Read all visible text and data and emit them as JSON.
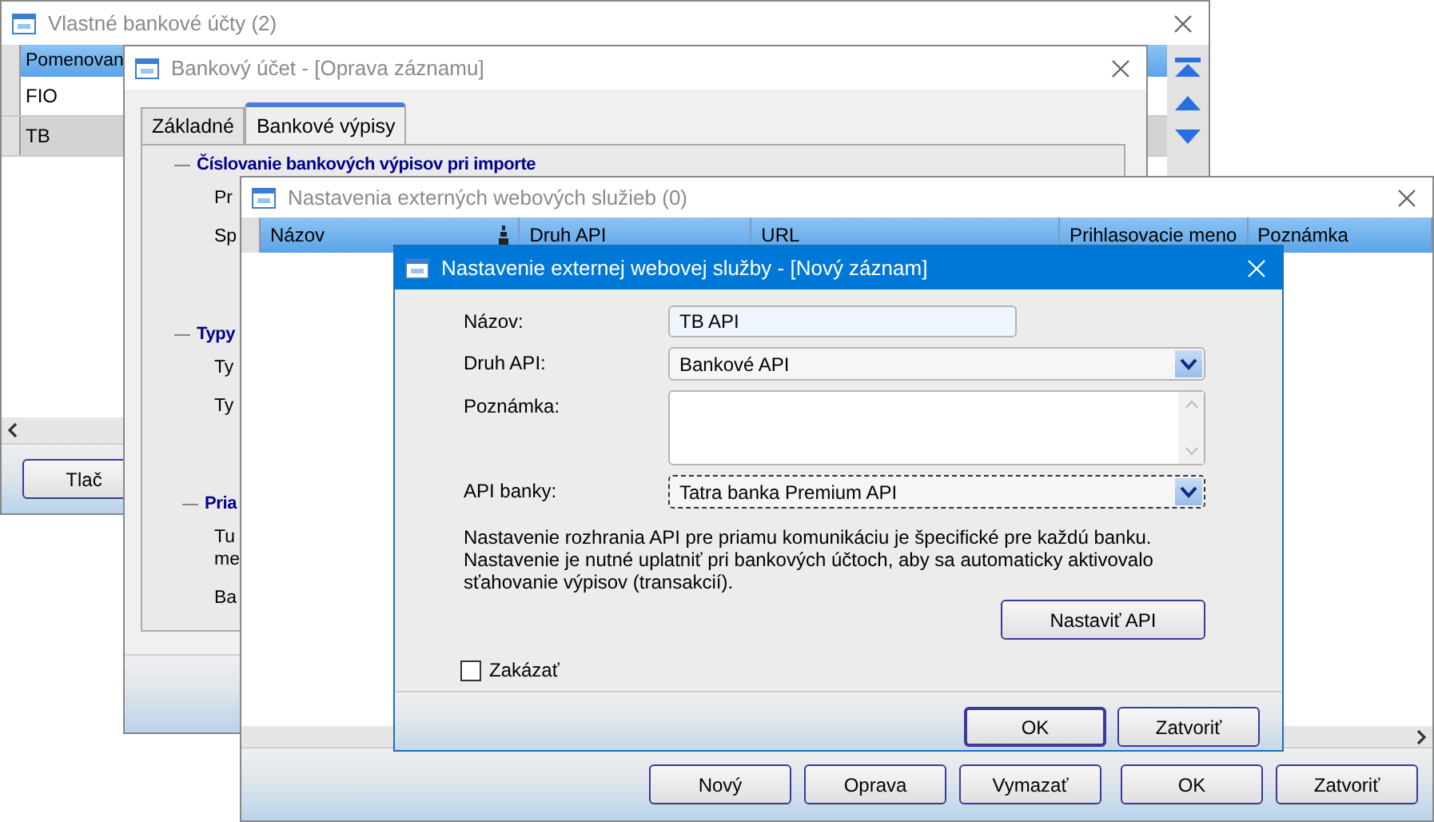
{
  "accounts_window": {
    "title": "Vlastné bankové účty (2)",
    "columns": [
      "Pomenovan"
    ],
    "rows": [
      {
        "cells": [
          "FIO"
        ],
        "selected": false
      },
      {
        "cells": [
          "TB"
        ],
        "selected": true
      }
    ],
    "buttons": [
      "Tlač"
    ]
  },
  "account_window": {
    "title": "Bankový účet - [Oprava záznamu]",
    "tabs": [
      {
        "label": "Základné",
        "selected": false
      },
      {
        "label": "Bankové výpisy",
        "selected": true
      }
    ],
    "sections": [
      {
        "heading": "Číslovanie bankových výpisov pri importe",
        "lines": [
          "Pr",
          "Sp"
        ]
      },
      {
        "heading": "Typy",
        "lines": [
          "Ty",
          "Ty"
        ]
      },
      {
        "heading": "Pria",
        "lines": [
          "Tu\nme",
          "Ba"
        ]
      }
    ]
  },
  "services_window": {
    "title": "Nastavenia externých webových služieb (0)",
    "columns": [
      "Názov",
      "Druh API",
      "URL",
      "Prihlasovacie meno",
      "Poznámka"
    ],
    "buttons": [
      "Nový",
      "Oprava",
      "Vymazať",
      "OK",
      "Zatvoriť"
    ]
  },
  "dialog": {
    "title": "Nastavenie externej webovej služby - [Nový záznam]",
    "fields": [
      {
        "kind": "text",
        "label": "Názov:",
        "value": "TB API",
        "focused": false
      },
      {
        "kind": "combo",
        "label": "Druh API:",
        "value": "Bankové API",
        "focused": false
      },
      {
        "kind": "memo",
        "label": "Poznámka:",
        "focused": false
      },
      {
        "kind": "combo",
        "label": "API banky:",
        "value": "Tatra banka Premium API",
        "focused": true
      }
    ],
    "note": "Nastavenie rozhrania API pre priamu komunikáciu je špecifické pre každú banku.\nNastavenie je nutné uplatniť pri bankových účtoch, aby sa automaticky aktivovalo\nsťahovanie výpisov (transakcií).",
    "setup_button": "Nastaviť API",
    "disable_checkbox": {
      "label": "Zakázať",
      "checked": false
    },
    "buttons": [
      "OK",
      "Zatvoriť"
    ]
  }
}
